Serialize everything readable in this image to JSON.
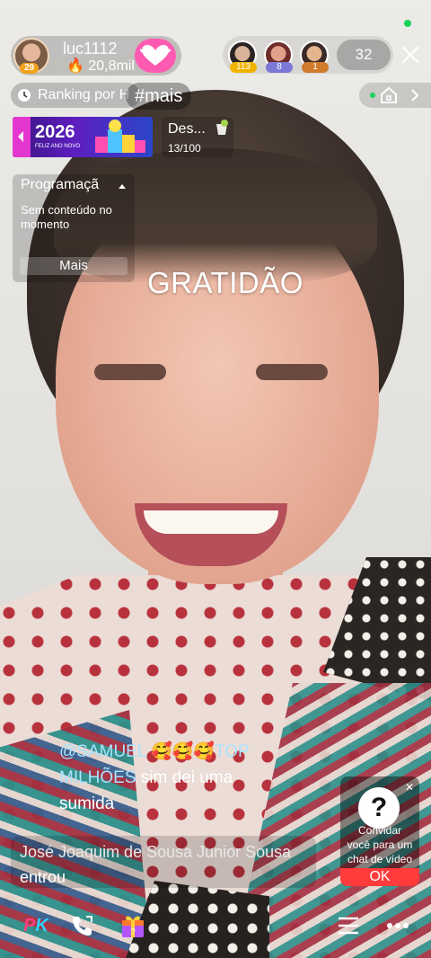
{
  "host": {
    "name": "luc1112",
    "level": "29",
    "likes": "20,8mil"
  },
  "viewers": {
    "top": [
      {
        "badge": "113",
        "badge_color": "#f0b400"
      },
      {
        "badge": "8",
        "badge_color": "#7b78d8"
      },
      {
        "badge": "1",
        "badge_color": "#d07a2b"
      }
    ],
    "count": "32"
  },
  "ranking": {
    "label": "Ranking por H"
  },
  "hashtag": {
    "label": "#mais"
  },
  "banner": {
    "year": "2026",
    "subtitle": "FELIZ ANO NOVO"
  },
  "goal": {
    "title": "Des...",
    "count": "13/100"
  },
  "programming": {
    "title": "Programaçã",
    "body": "Sem conteúdo no momento",
    "more": "Mais"
  },
  "overlay_title": "GRATIDÃO",
  "chat": {
    "mention": "@SAMUEL 🥰🥰🥰TOP MILHÕES",
    "message": " sim dei uma sumida"
  },
  "join": {
    "name": "José Joaquim de Sousa Junior Sousa",
    "action": " entrou"
  },
  "invite": {
    "text": "Convidar você para um chat de vídeo",
    "ok": "OK"
  },
  "bottom": {
    "pk": "PK"
  },
  "colors": {
    "follow": "#ff5ab2",
    "ok": "#ff3b3b",
    "mention": "#a8e3ff",
    "live_dot": "#19d35a"
  }
}
